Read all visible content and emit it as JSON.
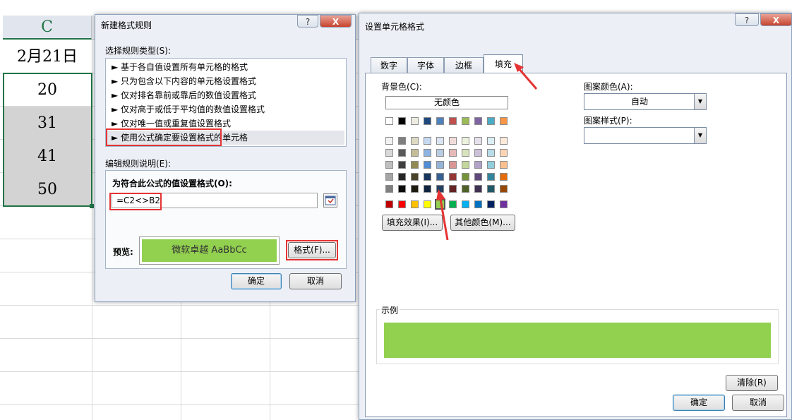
{
  "sheet": {
    "column_header": "C",
    "date_cell": "2月21日",
    "values": [
      "20",
      "31",
      "41",
      "50"
    ]
  },
  "new_rule_dialog": {
    "title": "新建格式规则",
    "help": "?",
    "close": "X",
    "select_type_label": "选择规则类型(S):",
    "rules": [
      "► 基于各自值设置所有单元格的格式",
      "► 只为包含以下内容的单元格设置格式",
      "► 仅对排名靠前或靠后的数值设置格式",
      "► 仅对高于或低于平均值的数值设置格式",
      "► 仅对唯一值或重复值设置格式",
      "► 使用公式确定要设置格式的单元格"
    ],
    "edit_desc_label": "编辑规则说明(E):",
    "formula_label": "为符合此公式的值设置格式(O):",
    "formula_value": "=C2<>B2",
    "preview_label": "预览:",
    "preview_text": "微软卓越  AaBbCc",
    "format_button": "格式(F)...",
    "ok": "确定",
    "cancel": "取消",
    "preview_color": "#92d050"
  },
  "format_cells_dialog": {
    "title": "设置单元格格式",
    "help": "?",
    "close": "X",
    "tabs": [
      "数字",
      "字体",
      "边框",
      "填充"
    ],
    "bg_color_label": "背景色(C):",
    "no_color": "无颜色",
    "pattern_color_label": "图案颜色(A):",
    "pattern_color_value": "自动",
    "pattern_style_label": "图案样式(P):",
    "pattern_style_value": "",
    "fill_effects": "填充效果(I)...",
    "more_colors": "其他颜色(M)...",
    "sample_label": "示例",
    "clear": "清除(R)",
    "ok": "确定",
    "cancel": "取消",
    "selected_color": "#92d050",
    "theme_row": [
      "#ffffff",
      "#000000",
      "#eeece1",
      "#1f497d",
      "#4f81bd",
      "#c0504d",
      "#9bbb59",
      "#8064a2",
      "#4bacc6",
      "#f79646"
    ],
    "shade_rows": [
      [
        "#f2f2f2",
        "#7f7f7f",
        "#ddd9c3",
        "#c6d9f0",
        "#dbe5f1",
        "#f2dcdb",
        "#ebf1dd",
        "#e5e0ec",
        "#dbeef3",
        "#fdeada"
      ],
      [
        "#d8d8d8",
        "#595959",
        "#c4bd97",
        "#8db3e2",
        "#b8cce4",
        "#e5b9b7",
        "#d7e3bc",
        "#ccc1d9",
        "#b7dde8",
        "#fbd5b5"
      ],
      [
        "#bfbfbf",
        "#3f3f3f",
        "#938953",
        "#548dd4",
        "#95b3d7",
        "#d99694",
        "#c3d69b",
        "#b2a2c7",
        "#92cddc",
        "#fac08f"
      ],
      [
        "#a5a5a5",
        "#262626",
        "#494429",
        "#17365d",
        "#366092",
        "#953734",
        "#76923c",
        "#5f497a",
        "#31859b",
        "#e36c09"
      ],
      [
        "#7f7f7f",
        "#0c0c0c",
        "#1d1b10",
        "#0f243e",
        "#244061",
        "#632423",
        "#4f6128",
        "#3f3151",
        "#205867",
        "#974806"
      ]
    ],
    "standard_row": [
      "#c00000",
      "#ff0000",
      "#ffc000",
      "#ffff00",
      "#92d050",
      "#00b050",
      "#00b0f0",
      "#0070c0",
      "#002060",
      "#7030a0"
    ]
  }
}
